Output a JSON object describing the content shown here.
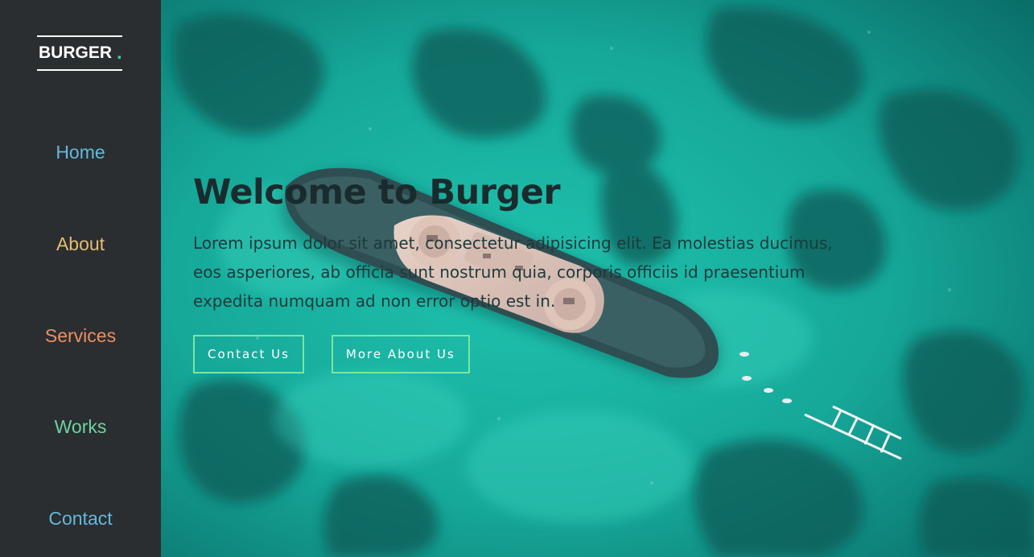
{
  "brand": {
    "name": "BURGER",
    "dot": ".",
    "dot_color": "#39d39f"
  },
  "nav": {
    "items": [
      {
        "label": "Home",
        "color": "#64b8dc"
      },
      {
        "label": "About",
        "color": "#e4bd74"
      },
      {
        "label": "Services",
        "color": "#ea8f64"
      },
      {
        "label": "Works",
        "color": "#6fd1a3"
      },
      {
        "label": "Contact",
        "color": "#64b8dc"
      }
    ]
  },
  "hero": {
    "title": "Welcome to Burger",
    "text": "Lorem ipsum dolor sit amet, consectetur adipisicing elit. Ea molestias ducimus, eos asperiores, ab officia sunt nostrum quia, corporis officiis id praesentium expedita numquam ad non error optio est in.",
    "buttons": [
      {
        "label": "Contact Us"
      },
      {
        "label": "More About Us"
      }
    ],
    "background_image": "aerial-ocean-shipwreck-photo",
    "accent_border_color": "#7ce6a0"
  }
}
